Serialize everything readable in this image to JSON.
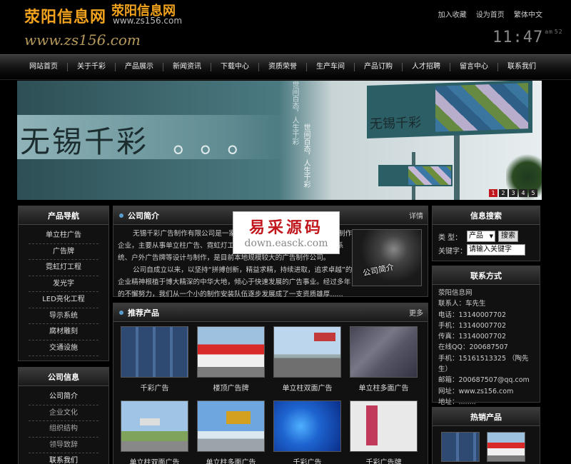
{
  "header": {
    "logo_cn": "荥阳信息网",
    "logo_cn2": "荥阳信息网",
    "logo_url_small": "www.zs156.com",
    "logo_url": "www.zs156.com",
    "top_links": [
      "加入收藏",
      "设为首页",
      "繁体中文"
    ],
    "clock_time": "11:47",
    "clock_ampm": "am",
    "clock_sec": "52"
  },
  "nav": [
    "网站首页",
    "关于千彩",
    "产品展示",
    "新闻资讯",
    "下载中心",
    "资质荣誉",
    "生产车间",
    "产品订购",
    "人才招聘",
    "留言中心",
    "联系我们"
  ],
  "banner": {
    "title": "无锡千彩",
    "dots": "。。。",
    "vert_text": "世间百态，人生千彩",
    "billboard_text": "无锡千彩",
    "pages": [
      "1",
      "2",
      "3",
      "4",
      "5"
    ],
    "active_page": 0
  },
  "sidebar": {
    "products_title": "产品导航",
    "products": [
      "单立柱广告",
      "广告牌",
      "霓虹灯工程",
      "发光字",
      "LED亮化工程",
      "导示系统",
      "腐材雕刻",
      "交通设施"
    ],
    "company_title": "公司信息",
    "company": [
      "公司简介",
      "企业文化",
      "组织结构",
      "领导致辞",
      "联系我们"
    ]
  },
  "intro": {
    "title": "公司简介",
    "more": "详情",
    "para1": "无锡千彩广告制作有限公司是一家集设计、制作于一体的综合性广告制作企业，主要从事单立柱广告、霓虹灯工程、LED亮化工程、发光字、导示系统、户外广告牌等设计与制作，是目前本地规模较大的广告制作公司。",
    "para2": "公司自成立以来，以坚持“拼搏创新，精益求精，持续进取，追求卓越”的企业精神根植于博大精深的中华大地，倾心于快速发展的广告事业。经过多年的不懈努力，我们从一个小的制作安装队伍逐步发展成了一支资质雄厚......",
    "image_caption": "公司简介"
  },
  "watermark": {
    "line1": "易采源码",
    "line2": "down.easck.com"
  },
  "products": {
    "title": "推荐产品",
    "more": "更多",
    "items": [
      {
        "caption": "千彩广告",
        "thumb": "t1"
      },
      {
        "caption": "楼顶广告牌",
        "thumb": "t2"
      },
      {
        "caption": "单立柱双面广告",
        "thumb": "t3"
      },
      {
        "caption": "单立柱多面广告",
        "thumb": "t4"
      },
      {
        "caption": "单立柱双面广告",
        "thumb": "t5"
      },
      {
        "caption": "单立柱多面广告",
        "thumb": "t6"
      },
      {
        "caption": "千彩广告",
        "thumb": "t7"
      },
      {
        "caption": "千彩广告牌",
        "thumb": "t8"
      }
    ]
  },
  "search": {
    "title": "信息搜索",
    "type_label": "类  型：",
    "type_value": "产品",
    "search_button": "搜索",
    "keyword_label": "关键字：",
    "keyword_placeholder": "请输入关键字"
  },
  "contact": {
    "title": "联系方式",
    "lines": [
      "荥阳信息网",
      "联系人：车先生",
      "电话：13140007702",
      "手机：13140007702",
      "传真：13140007702",
      "在线QQ：200687507",
      "手机：15161513325 （陶先生）",
      "邮箱：200687507@qq.com",
      "网址：www.zs156.com",
      "地址：........"
    ]
  },
  "hot": {
    "title": "热销产品"
  }
}
